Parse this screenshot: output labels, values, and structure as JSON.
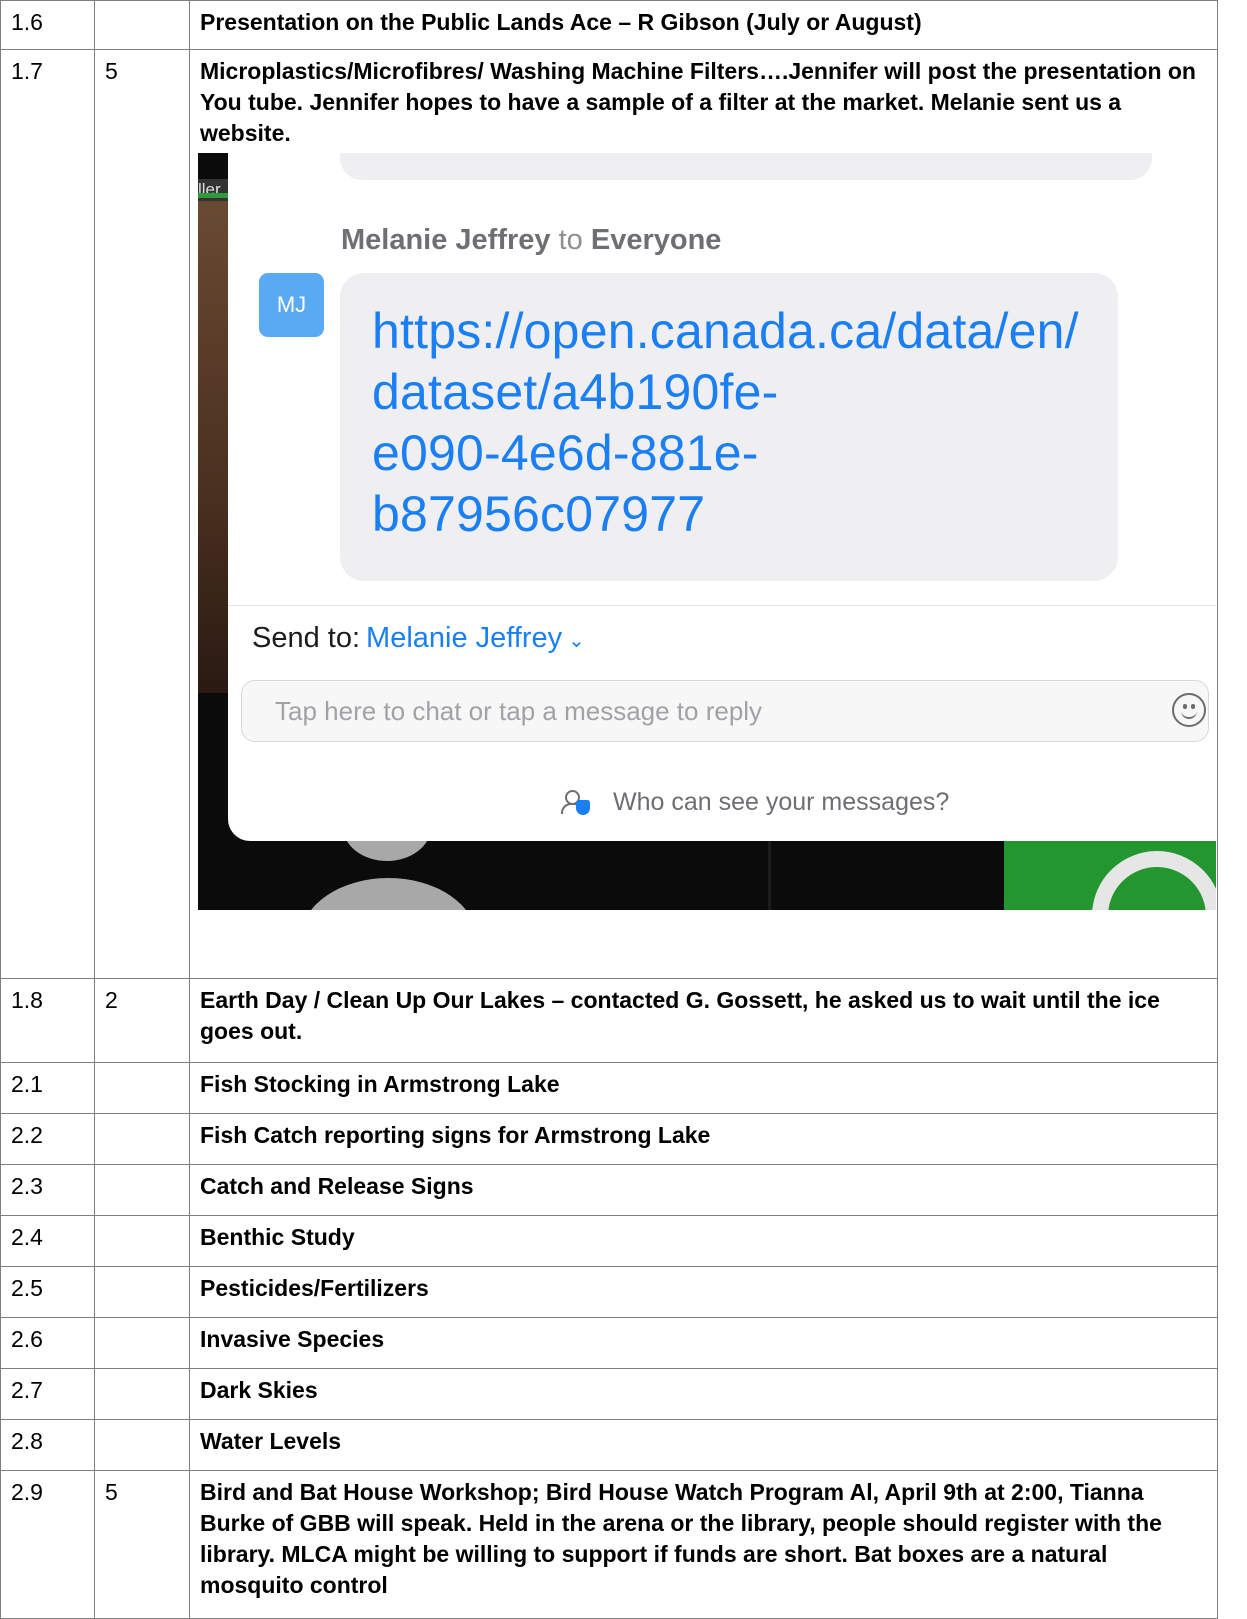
{
  "rows": [
    {
      "num": "1.6",
      "count": "",
      "text": "Presentation on the Public Lands Ace – R Gibson (July or August)"
    },
    {
      "num": "1.7",
      "count": "5",
      "text": "Microplastics/Microfibres/ Washing Machine Filters….Jennifer will post the presentation on You tube.   Jennifer hopes to have a sample of a filter at the market.  Melanie sent  us a website."
    },
    {
      "num": "1.8",
      "count": "2",
      "text": "Earth Day / Clean Up Our Lakes – contacted G. Gossett, he asked us to wait until the ice goes out."
    },
    {
      "num": "2.1",
      "count": "",
      "text": "Fish Stocking in Armstrong Lake"
    },
    {
      "num": "2.2",
      "count": "",
      "text": "Fish Catch reporting signs for Armstrong Lake"
    },
    {
      "num": "2.3",
      "count": "",
      "text": "Catch and Release Signs"
    },
    {
      "num": "2.4",
      "count": "",
      "text": "Benthic Study"
    },
    {
      "num": "2.5",
      "count": "",
      "text": "Pesticides/Fertilizers"
    },
    {
      "num": "2.6",
      "count": "",
      "text": "Invasive Species"
    },
    {
      "num": "2.7",
      "count": "",
      "text": "Dark Skies"
    },
    {
      "num": "2.8",
      "count": "",
      "text": "Water Levels"
    },
    {
      "num": "2.9",
      "count": "5",
      "text": "Bird and Bat House Workshop; Bird House Watch Program  Al, April 9th at 2:00, Tianna Burke of GBB will speak.  Held in the arena or the library, people should register with the library.  MLCA might be willing to support if funds are short.  Bat boxes are a natural mosquito control"
    }
  ],
  "chat": {
    "background_label": "ller",
    "sender_name": "Melanie Jeffrey",
    "sender_to": "to",
    "sender_group": "Everyone",
    "avatar_initials": "MJ",
    "link_lines": [
      "https://open.canada.ca/data/en/",
      "dataset/a4b190fe-",
      "e090-4e6d-881e-",
      "b87956c07977"
    ],
    "send_to_label": "Send to:",
    "send_to_recipient": "Melanie Jeffrey",
    "send_to_chevron": "⌄",
    "input_placeholder": "Tap here to chat or tap a message to reply",
    "privacy_text": "Who can see your messages?",
    "icons": {
      "emoji": "smiley-face-icon",
      "privacy": "person-shield-icon",
      "chevron": "chevron-down-icon"
    },
    "colors": {
      "link": "#1a7ff2",
      "avatar": "#5aa9f3",
      "bubble": "#efeff2",
      "tile": "#23962f"
    }
  }
}
